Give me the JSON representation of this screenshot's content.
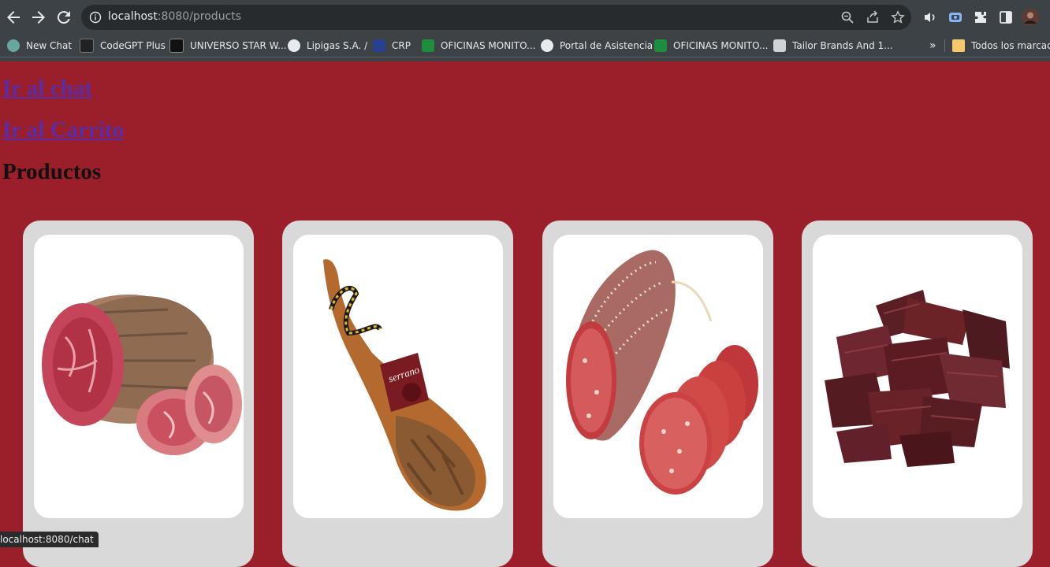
{
  "browser": {
    "url_host": "localhost",
    "url_rest": ":8080/products",
    "bookmarks": [
      {
        "label": "New Chat",
        "color": "#6aa6a0"
      },
      {
        "label": "CodeGPT Plus",
        "color": "#222222"
      },
      {
        "label": "UNIVERSO STAR W...",
        "color": "#111111"
      },
      {
        "label": "Lipigas S.A. /",
        "color": "#e8eaed"
      },
      {
        "label": "CRP",
        "color": "#2a3f8f"
      },
      {
        "label": "OFICINAS MONITO...",
        "color": "#1e8e3e"
      },
      {
        "label": "Portal de Asistencia",
        "color": "#e8eaed"
      },
      {
        "label": "OFICINAS MONITO...",
        "color": "#1e8e3e"
      },
      {
        "label": "Tailor Brands And 1...",
        "color": "#cfd3d6"
      }
    ],
    "more_label": "»",
    "all_bookmarks_label": "Todos los marcado"
  },
  "page": {
    "chat_link": "Ir al chat",
    "cart_link": "Ir al Carrito",
    "heading": "Productos",
    "products": [
      {
        "image": "bondiola-ham-image"
      },
      {
        "image": "serrano-leg-image",
        "label_text": "serrano"
      },
      {
        "image": "salami-image"
      },
      {
        "image": "beef-jerky-image"
      }
    ]
  },
  "status_bar": "localhost:8080/chat",
  "colors": {
    "page_bg": "#9a1f2a",
    "card_bg": "#d9d9d9",
    "link": "#5a2da8"
  }
}
